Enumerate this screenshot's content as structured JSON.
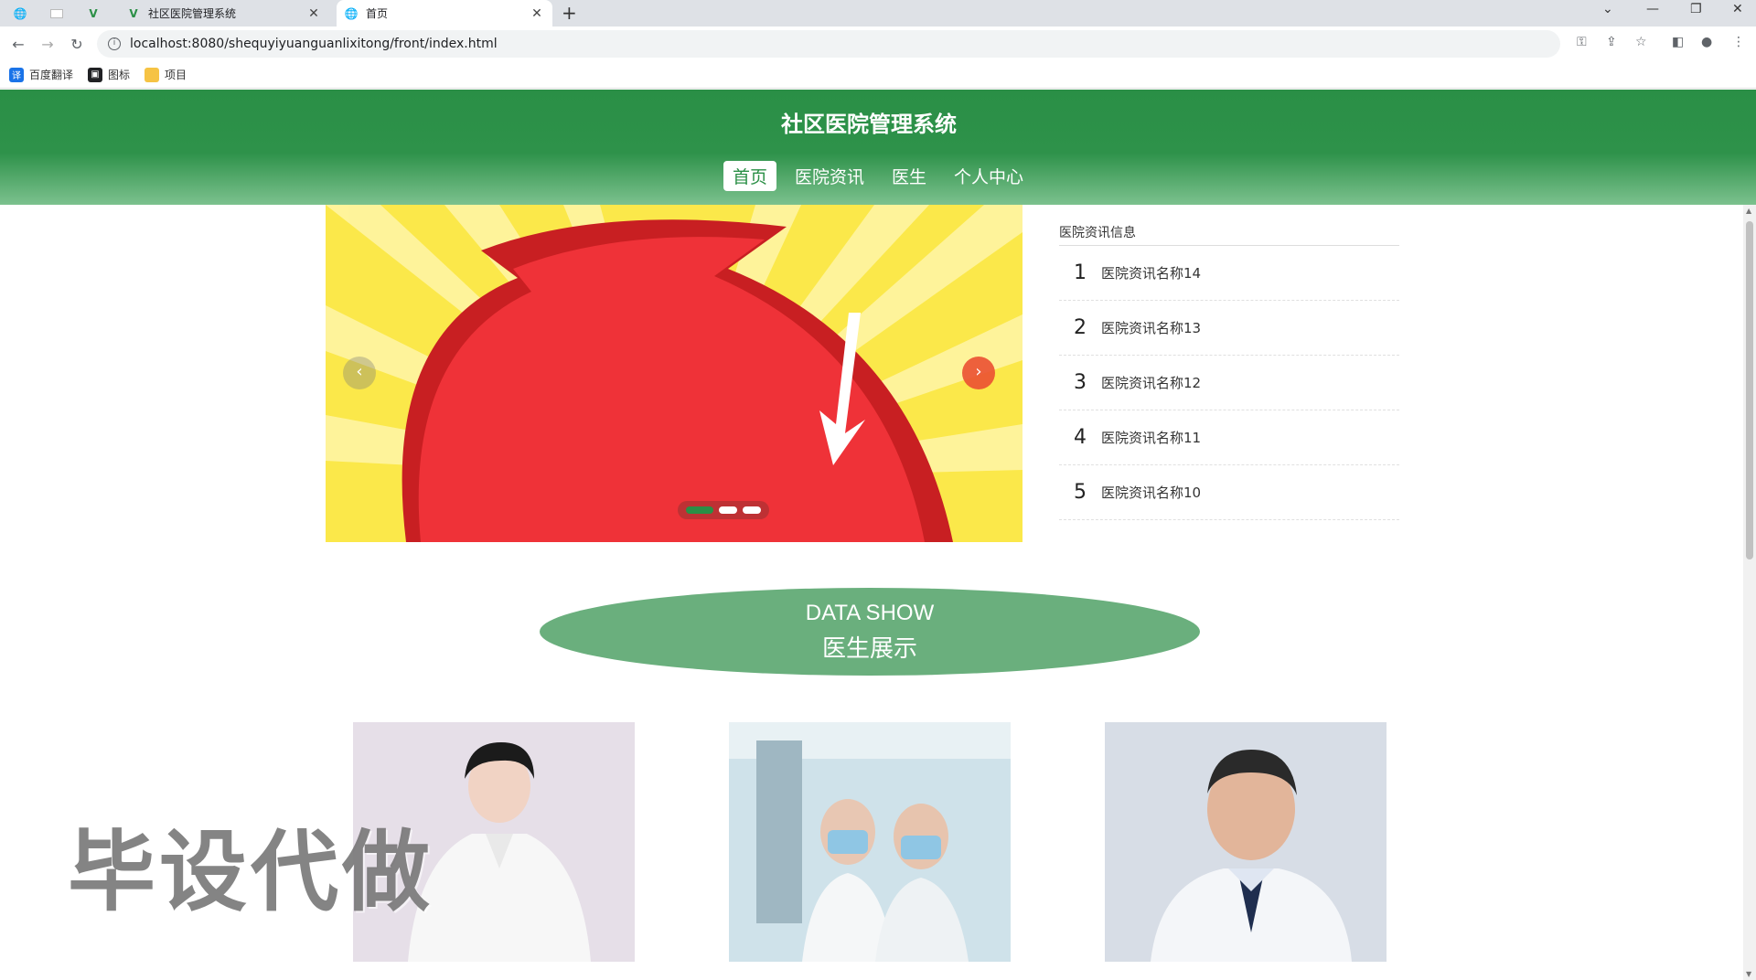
{
  "browser": {
    "tabs": [
      {
        "title": "社区医院管理系统"
      },
      {
        "title": "首页"
      }
    ],
    "url": "localhost:8080/shequyiyuanguanlixitong/front/index.html",
    "bookmarks": [
      {
        "label": "百度翻译",
        "icon": "translate-icon",
        "color": "#1a73e8"
      },
      {
        "label": "图标",
        "icon": "image-icon",
        "color": "#202124"
      },
      {
        "label": "项目",
        "icon": "folder-icon",
        "color": "#f6c344"
      }
    ]
  },
  "site": {
    "title": "社区医院管理系统",
    "nav": [
      {
        "label": "首页",
        "active": true
      },
      {
        "label": "医院资讯",
        "active": false
      },
      {
        "label": "医生",
        "active": false
      },
      {
        "label": "个人中心",
        "active": false
      }
    ],
    "accent": "#2a8f46"
  },
  "carousel": {
    "slide_count": 3,
    "active_index": 0
  },
  "news": {
    "heading": "医院资讯信息",
    "items": [
      {
        "num": "1",
        "title": "医院资讯名称14"
      },
      {
        "num": "2",
        "title": "医院资讯名称13"
      },
      {
        "num": "3",
        "title": "医院资讯名称12"
      },
      {
        "num": "4",
        "title": "医院资讯名称11"
      },
      {
        "num": "5",
        "title": "医院资讯名称10"
      }
    ]
  },
  "section": {
    "title_en": "DATA SHOW",
    "title_cn": "医生展示"
  },
  "watermark": "毕设代做"
}
